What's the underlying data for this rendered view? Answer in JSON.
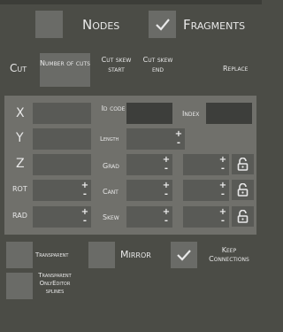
{
  "header": {
    "nodes_label": "Nodes",
    "fragments_label": "Fragments",
    "nodes_checked": false,
    "fragments_checked": true
  },
  "cut_row": {
    "cut_label": "Cut",
    "number_of_cuts_label": "Number of cuts",
    "cut_skew_start_label": "Cut skew start",
    "cut_skew_end_label": "Cut skew end",
    "replace_label": "Replace"
  },
  "fields": {
    "x_label": "X",
    "y_label": "Y",
    "z_label": "Z",
    "rot_label": "ROT",
    "rad_label": "RAD",
    "id_code_label": "Id code",
    "length_label": "Length",
    "grad_label": "Grad",
    "cant_label": "Cant",
    "skew_label": "Skew",
    "index_label": "Index",
    "plus": "+",
    "minus": "-"
  },
  "options": {
    "transparent_label": "Transparent",
    "mirror_label": "Mirror",
    "keep_connections_label": "Keep Connections",
    "transparent_only_editor_splines_label": "Transparent OnlyEditor splines",
    "keep_connections_checked": true
  },
  "colors": {
    "background": "#4b4c46",
    "panel": "#70706b",
    "field": "#595a56",
    "dark_field": "#3d3e3b",
    "button": "#6a6b67",
    "text": "#e8e8e8"
  },
  "icons": {
    "check": "check-icon",
    "lock": "unlock-icon"
  }
}
